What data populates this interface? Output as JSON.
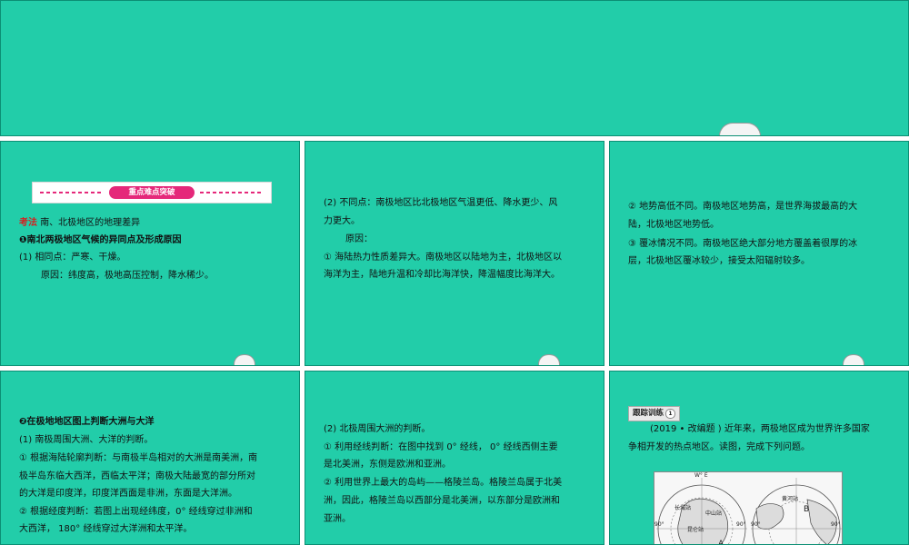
{
  "slide1": {
    "banner": "重点难点突破",
    "kaofa_label": "考法",
    "kaofa_text": "南、北极地区的地理差异",
    "point1_title": "❶南北两极地区气候的异同点及形成原因",
    "same_label": "(1) 相同点：严寒、干燥。",
    "same_reason": "原因：纬度高，极地高压控制，降水稀少。"
  },
  "slide2": {
    "line1": "(2) 不同点：南极地区比北极地区气温更低、降水更少、风",
    "line2": "力更大。",
    "line3": "原因：",
    "line4": "① 海陆热力性质差异大。南极地区以陆地为主，北极地区以",
    "line5": "海洋为主，陆地升温和冷却比海洋快，降温幅度比海洋大。"
  },
  "slide3": {
    "line1": "② 地势高低不同。南极地区地势高，是世界海拔最高的大",
    "line2": "陆，北极地区地势低。",
    "line3": "③ 覆冰情况不同。南极地区绝大部分地方覆盖着很厚的冰",
    "line4": "层，北极地区覆冰较少，接受太阳辐射较多。"
  },
  "slide4": {
    "line1": "❷在极地地区图上判断大洲与大洋",
    "line2": "(1) 南极周围大洲、大洋的判断。",
    "line3": "① 根据海陆轮廓判断：与南极半岛相对的大洲是南美洲，南",
    "line4": "极半岛东临大西洋，西临太平洋；南极大陆最宽的部分所对",
    "line5": "的大洋是印度洋，印度洋西面是非洲，东面是大洋洲。",
    "line6": "② 根据经度判断：若图上出现经纬度，0° 经线穿过非洲和",
    "line7": "大西洋， 180° 经线穿过大洋洲和太平洋。"
  },
  "slide5": {
    "line1": "(2) 北极周围大洲的判断。",
    "line2": "① 利用经线判断：在图中找到 0° 经线， 0° 经线西侧主要",
    "line3": "是北美洲，东侧是欧洲和亚洲。",
    "line4": "② 利用世界上最大的岛屿——格陵兰岛。格陵兰岛属于北美",
    "line5": "洲，因此，格陵兰岛以西部分是北美洲，以东部分是欧洲和",
    "line6": "亚洲。"
  },
  "slide6": {
    "tag": "跟踪训练",
    "tag_num": "1",
    "line1": "(2019 • 改编题 ) 近年来，两极地区成为世界许多国家",
    "line2": "争相开发的热点地区。读图，完成下列问题。",
    "map_labels": {
      "top": "W° E",
      "left_edge": "90°",
      "mid_left": "90°",
      "mid_right": "90°",
      "right_edge": "90°",
      "station1": "长城站",
      "station2": "中山站",
      "station3": "昆仑站",
      "letter_a": "A",
      "letter_b": "B",
      "region": "黄河站"
    }
  },
  "colors": {
    "slide_bg": "#22cda9",
    "banner_accent": "#e5287a",
    "kaofa_red": "#d42020"
  }
}
